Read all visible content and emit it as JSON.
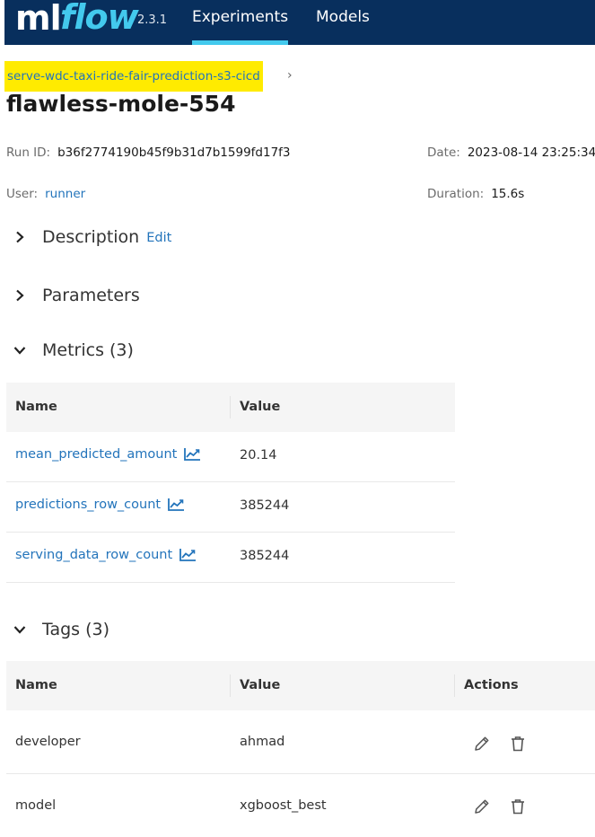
{
  "header": {
    "logo_ml": "ml",
    "logo_flow": "flow",
    "version": "2.3.1",
    "nav": [
      {
        "label": "Experiments",
        "active": true
      },
      {
        "label": "Models",
        "active": false
      }
    ],
    "accent_color": "#43c9ed",
    "bg_color": "#082f5d"
  },
  "breadcrumb": {
    "experiment_link": "serve-wdc-taxi-ride-fair-prediction-s3-cicd",
    "separator": "›"
  },
  "run": {
    "title": "flawless-mole-554",
    "run_id_label": "Run ID:",
    "run_id": "b36f2774190b45f9b31d7b1599fd17f3",
    "date_label": "Date:",
    "date": "2023-08-14 23:25:34",
    "user_label": "User:",
    "user": "runner",
    "duration_label": "Duration:",
    "duration": "15.6s"
  },
  "sections": {
    "description": {
      "title": "Description",
      "edit": "Edit",
      "icon": "chevron-right-icon"
    },
    "parameters": {
      "title": "Parameters",
      "icon": "chevron-right-icon"
    },
    "metrics": {
      "title": "Metrics",
      "count": "(3)",
      "icon": "chevron-down-icon"
    },
    "tags": {
      "title": "Tags",
      "count": "(3)",
      "icon": "chevron-down-icon"
    }
  },
  "metrics_table": {
    "headers": [
      "Name",
      "Value"
    ],
    "rows": [
      {
        "name": "mean_predicted_amount",
        "value": "20.14",
        "icon": "line-chart-icon"
      },
      {
        "name": "predictions_row_count",
        "value": "385244",
        "icon": "line-chart-icon"
      },
      {
        "name": "serving_data_row_count",
        "value": "385244",
        "icon": "line-chart-icon"
      }
    ]
  },
  "tags_table": {
    "headers": [
      "Name",
      "Value",
      "Actions"
    ],
    "rows": [
      {
        "name": "developer",
        "value": "ahmad",
        "actions": [
          "pencil-icon",
          "trash-icon"
        ]
      },
      {
        "name": "model",
        "value": "xgboost_best",
        "actions": [
          "pencil-icon",
          "trash-icon"
        ]
      }
    ]
  },
  "colors": {
    "link": "#2374bb",
    "highlight": "#ffeb00"
  }
}
